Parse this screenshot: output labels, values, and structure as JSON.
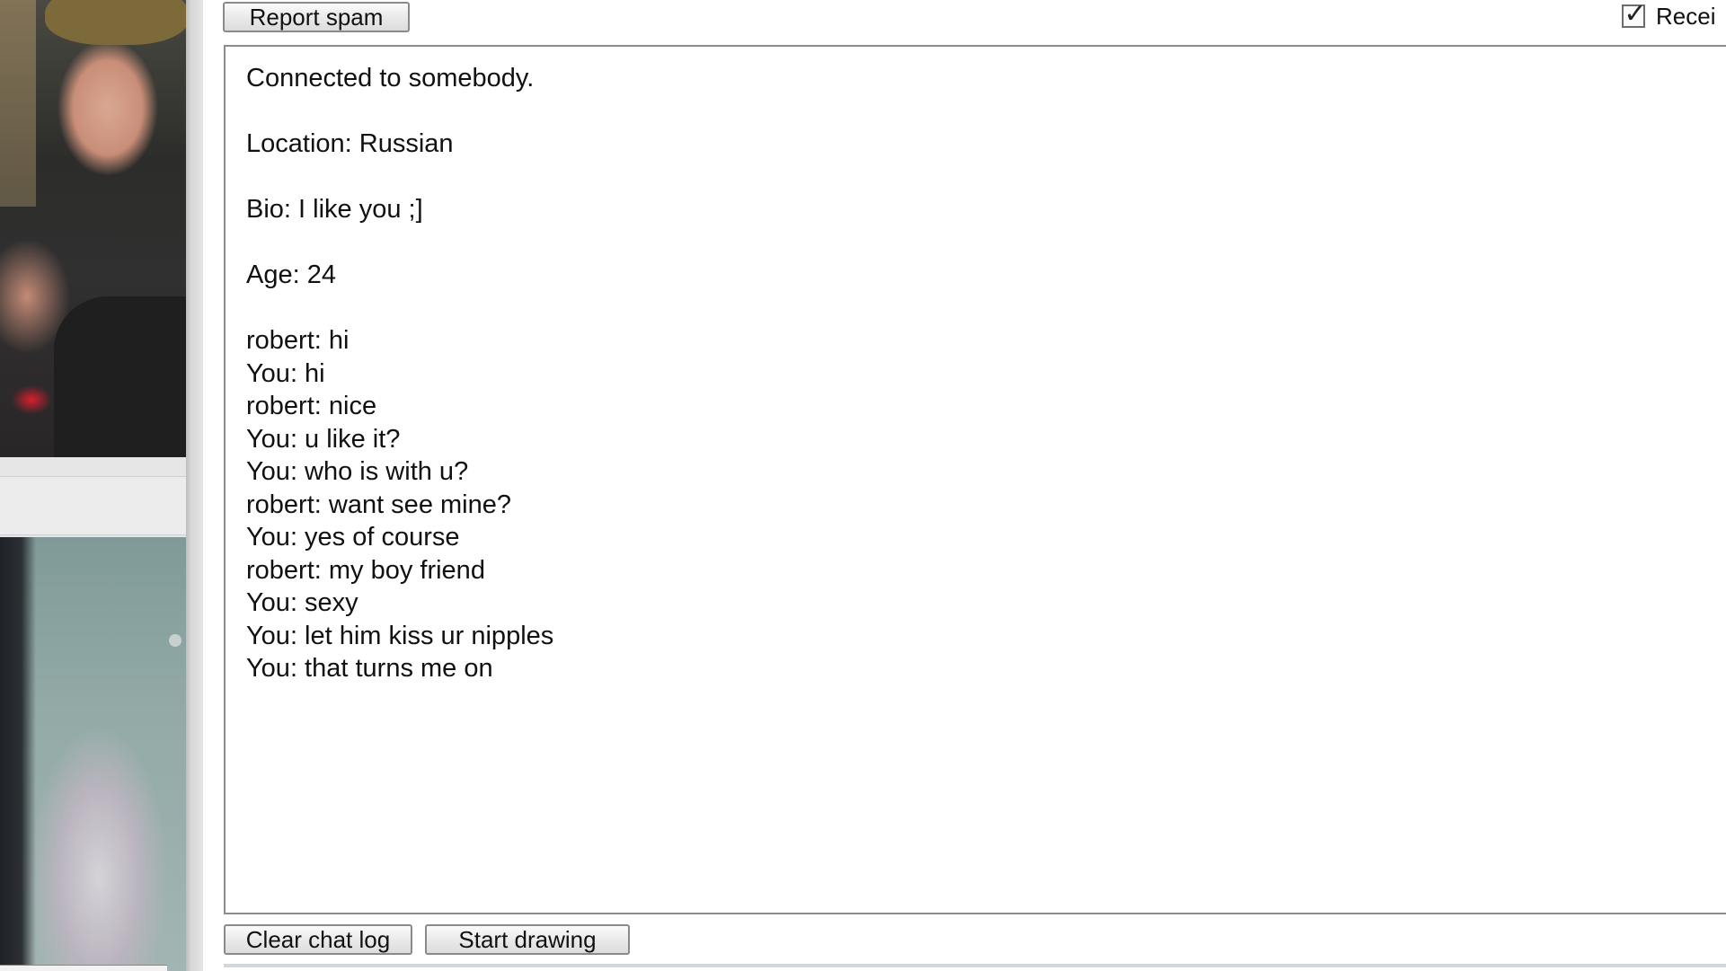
{
  "toolbar": {
    "report_label": "Report spam",
    "receive_label": "Recei",
    "receive_checked": true
  },
  "chat": {
    "info": [
      "Connected to somebody.",
      "Location: Russian",
      "Bio: I like you ;]",
      "Age: 24"
    ],
    "messages": [
      "robert: hi",
      "You: hi",
      "robert: nice",
      "You: u like it?",
      "You: who is with u?",
      "robert: want see mine?",
      "You: yes of course",
      "robert: my boy friend",
      "You: sexy",
      "You: let him kiss ur nipples",
      "You: that turns me on"
    ]
  },
  "footer": {
    "clear_label": "Clear chat log",
    "draw_label": "Start drawing"
  },
  "icons": {
    "checkbox": "check-icon"
  }
}
